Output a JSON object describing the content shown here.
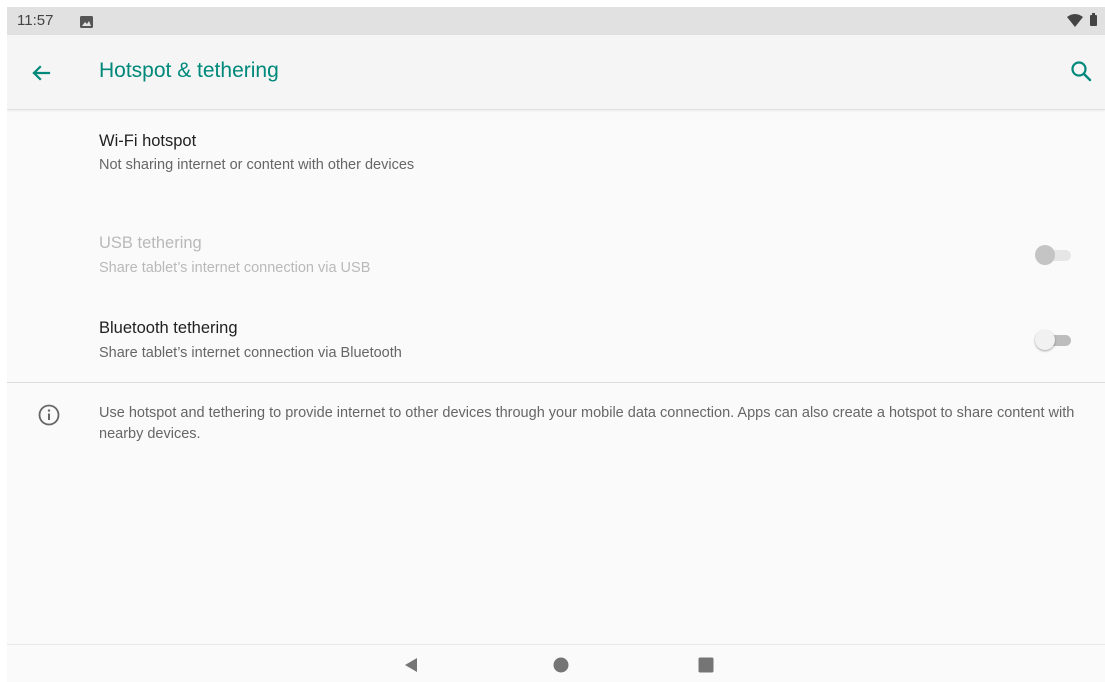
{
  "status_bar": {
    "time": "11:57",
    "icons": [
      "image-icon",
      "wifi-icon",
      "battery-icon"
    ]
  },
  "app_bar": {
    "title": "Hotspot & tethering",
    "accent_color": "#00897b",
    "icons": [
      "back-arrow-icon",
      "search-icon"
    ]
  },
  "settings": {
    "wifi_hotspot": {
      "title": "Wi-Fi hotspot",
      "summary": "Not sharing internet or content with other devices"
    },
    "usb_tethering": {
      "title": "USB tethering",
      "summary": "Share tablet’s internet connection via USB",
      "enabled": false,
      "checked": false
    },
    "bluetooth_tethering": {
      "title": "Bluetooth tethering",
      "summary": "Share tablet’s internet connection via Bluetooth",
      "enabled": true,
      "checked": false
    }
  },
  "footer_info": {
    "icon": "info-icon",
    "text": "Use hotspot and tethering to provide internet to other devices through your mobile data connection. Apps can also create a hotspot to share content with nearby devices."
  },
  "nav_bar": {
    "icons": [
      "nav-back-icon",
      "nav-home-icon",
      "nav-recents-icon"
    ]
  }
}
